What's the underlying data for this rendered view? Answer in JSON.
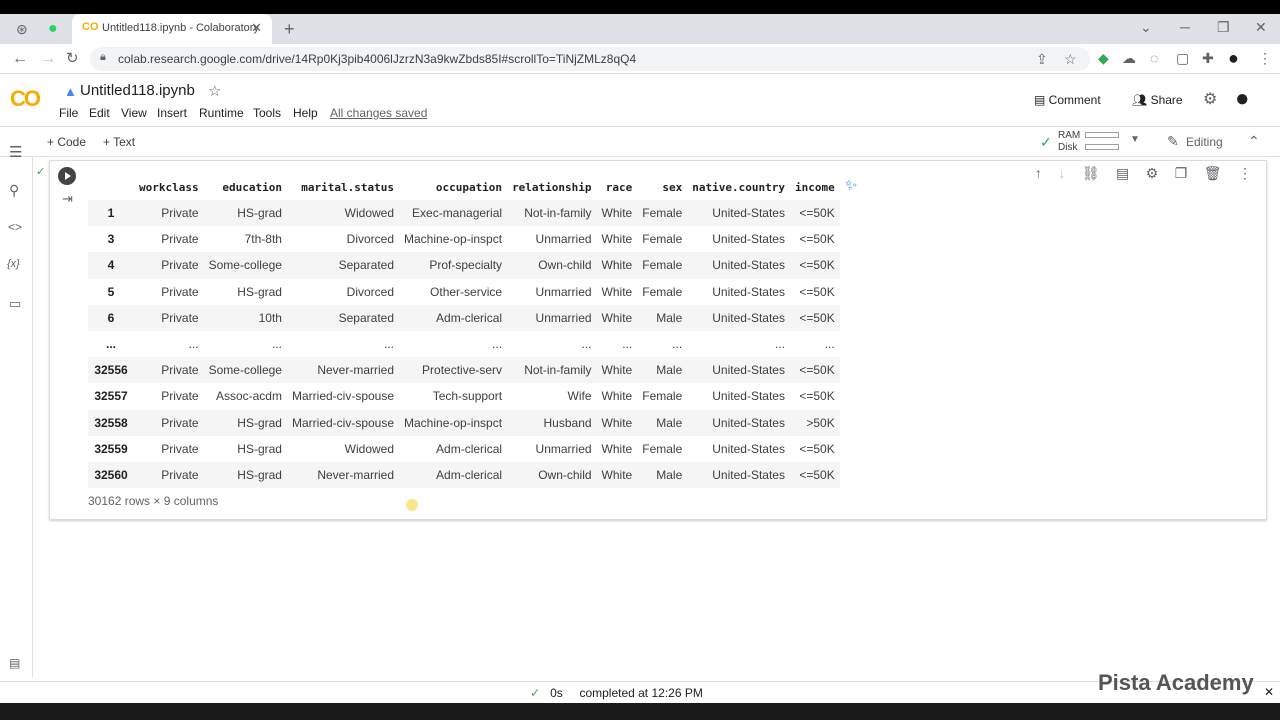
{
  "browser": {
    "tab_title": "Untitled118.ipynb - Colaboratory",
    "url": "colab.research.google.com/drive/14Rp0Kj3pib4006lJzrzN3a9kwZbds85I#scrollTo=TiNjZMLz8qQ4"
  },
  "colab": {
    "logo": "CO",
    "notebook_title": "Untitled118.ipynb",
    "menus": [
      "File",
      "Edit",
      "View",
      "Insert",
      "Runtime",
      "Tools",
      "Help"
    ],
    "saved_status": "All changes saved",
    "comment_label": "Comment",
    "share_label": "Share"
  },
  "toolbar": {
    "code_label": "+ Code",
    "text_label": "+ Text",
    "ram_label": "RAM",
    "disk_label": "Disk",
    "editing_label": "Editing"
  },
  "table": {
    "columns": [
      "",
      "workclass",
      "education",
      "marital.status",
      "occupation",
      "relationship",
      "race",
      "sex",
      "native.country",
      "income"
    ],
    "rows": [
      [
        "1",
        "Private",
        "HS-grad",
        "Widowed",
        "Exec-managerial",
        "Not-in-family",
        "White",
        "Female",
        "United-States",
        "<=50K"
      ],
      [
        "3",
        "Private",
        "7th-8th",
        "Divorced",
        "Machine-op-inspct",
        "Unmarried",
        "White",
        "Female",
        "United-States",
        "<=50K"
      ],
      [
        "4",
        "Private",
        "Some-college",
        "Separated",
        "Prof-specialty",
        "Own-child",
        "White",
        "Female",
        "United-States",
        "<=50K"
      ],
      [
        "5",
        "Private",
        "HS-grad",
        "Divorced",
        "Other-service",
        "Unmarried",
        "White",
        "Female",
        "United-States",
        "<=50K"
      ],
      [
        "6",
        "Private",
        "10th",
        "Separated",
        "Adm-clerical",
        "Unmarried",
        "White",
        "Male",
        "United-States",
        "<=50K"
      ],
      [
        "...",
        "...",
        "...",
        "...",
        "...",
        "...",
        "...",
        "...",
        "...",
        "..."
      ],
      [
        "32556",
        "Private",
        "Some-college",
        "Never-married",
        "Protective-serv",
        "Not-in-family",
        "White",
        "Male",
        "United-States",
        "<=50K"
      ],
      [
        "32557",
        "Private",
        "Assoc-acdm",
        "Married-civ-spouse",
        "Tech-support",
        "Wife",
        "White",
        "Female",
        "United-States",
        "<=50K"
      ],
      [
        "32558",
        "Private",
        "HS-grad",
        "Married-civ-spouse",
        "Machine-op-inspct",
        "Husband",
        "White",
        "Male",
        "United-States",
        ">50K"
      ],
      [
        "32559",
        "Private",
        "HS-grad",
        "Widowed",
        "Adm-clerical",
        "Unmarried",
        "White",
        "Female",
        "United-States",
        "<=50K"
      ],
      [
        "32560",
        "Private",
        "HS-grad",
        "Never-married",
        "Adm-clerical",
        "Own-child",
        "White",
        "Male",
        "United-States",
        "<=50K"
      ]
    ],
    "shape": "30162 rows × 9 columns"
  },
  "status": {
    "check": "✓",
    "duration": "0s",
    "completed": "completed at 12:26 PM"
  },
  "watermark": "Pista Academy"
}
